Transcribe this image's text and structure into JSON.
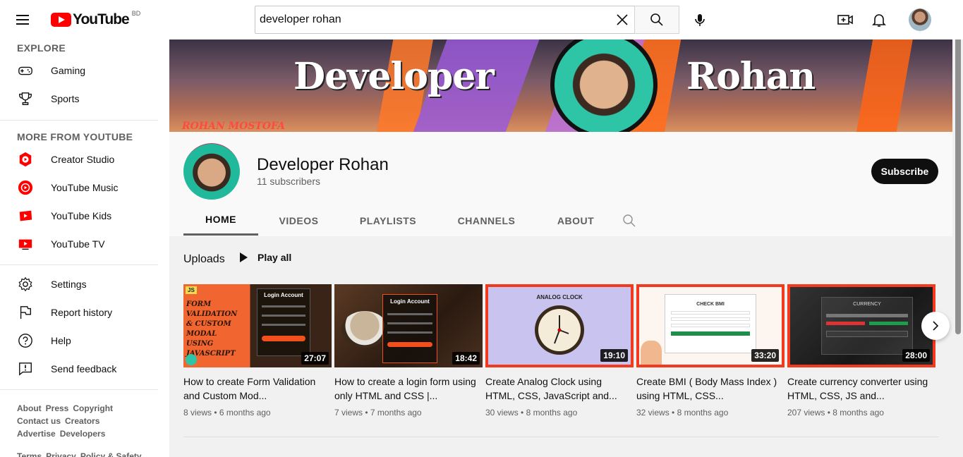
{
  "header": {
    "logo_text": "YouTube",
    "country_code": "BD",
    "search_value": "developer rohan"
  },
  "sidebar": {
    "explore_heading": "EXPLORE",
    "explore_items": [
      {
        "label": "Gaming",
        "icon": "gamepad-icon"
      },
      {
        "label": "Sports",
        "icon": "trophy-icon"
      }
    ],
    "more_heading": "MORE FROM YOUTUBE",
    "more_items": [
      {
        "label": "Creator Studio",
        "icon": "creator-studio-icon"
      },
      {
        "label": "YouTube Music",
        "icon": "youtube-music-icon"
      },
      {
        "label": "YouTube Kids",
        "icon": "youtube-kids-icon"
      },
      {
        "label": "YouTube TV",
        "icon": "youtube-tv-icon"
      }
    ],
    "settings_items": [
      {
        "label": "Settings",
        "icon": "gear-icon"
      },
      {
        "label": "Report history",
        "icon": "flag-icon"
      },
      {
        "label": "Help",
        "icon": "help-icon"
      },
      {
        "label": "Send feedback",
        "icon": "feedback-icon"
      }
    ],
    "footer_rows": [
      [
        "About",
        "Press",
        "Copyright"
      ],
      [
        "Contact us",
        "Creators"
      ],
      [
        "Advertise",
        "Developers"
      ],
      [
        "Terms",
        "Privacy",
        "Policy & Safety"
      ]
    ]
  },
  "banner": {
    "left_text": "Developer",
    "right_text": "Rohan",
    "tag": "ROHAN MOSTOFA"
  },
  "channel": {
    "name": "Developer Rohan",
    "subscribers": "11 subscribers",
    "subscribe_label": "Subscribe"
  },
  "tabs": [
    "HOME",
    "VIDEOS",
    "PLAYLISTS",
    "CHANNELS",
    "ABOUT"
  ],
  "active_tab": "HOME",
  "uploads": {
    "title": "Uploads",
    "play_all": "Play all",
    "videos": [
      {
        "title": "How to create Form Validation and Custom Mod...",
        "duration": "27:07",
        "views": "8 views",
        "age": "6 months ago"
      },
      {
        "title": "How to create a login form using only HTML and CSS |...",
        "duration": "18:42",
        "views": "7 views",
        "age": "7 months ago"
      },
      {
        "title": "Create Analog Clock using HTML, CSS, JavaScript and...",
        "duration": "19:10",
        "views": "30 views",
        "age": "8 months ago"
      },
      {
        "title": "Create BMI ( Body Mass Index ) using HTML, CSS...",
        "duration": "33:20",
        "views": "32 views",
        "age": "8 months ago"
      },
      {
        "title": "Create currency converter using HTML, CSS, JS and...",
        "duration": "28:00",
        "views": "207 views",
        "age": "8 months ago"
      }
    ],
    "thumb_text": {
      "t1_badge": "JS",
      "t1_words": "FORM VALIDATION & CUSTOM MODAL USING JAVASCRIPT",
      "login_heading": "Login Account",
      "clock_heading": "ANALOG CLOCK",
      "bmi_heading": "CHECK BMI",
      "currency_heading": "CURRENCY"
    }
  },
  "colors": {
    "brand_red": "#ff0000",
    "subscribe_bg": "#0f0f0f",
    "thumb_border": "#f23b1e"
  }
}
